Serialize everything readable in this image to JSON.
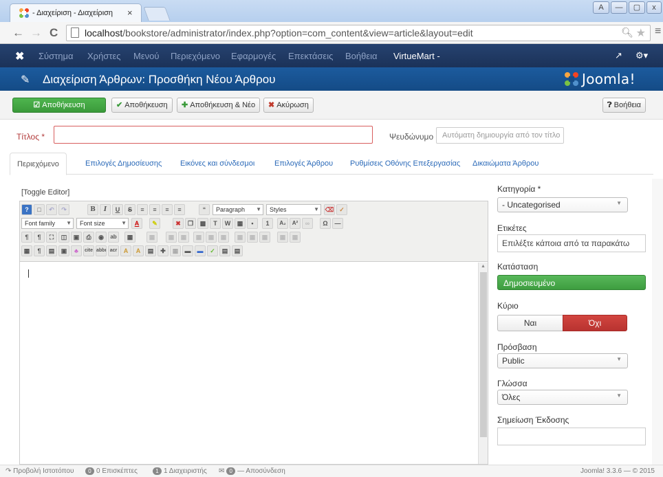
{
  "browser": {
    "tab_title": "- Διαχείριση - Διαχείριση",
    "tab_close": "×",
    "window_buttons": [
      "A",
      "—",
      "▢",
      "x"
    ],
    "url_host": "localhost",
    "url_path": "/bookstore/administrator/index.php?option=com_content&view=article&layout=edit",
    "back_icon": "←",
    "forward_icon": "→",
    "reload_icon": "C"
  },
  "admin_nav": {
    "items": [
      "Σύστημα",
      "Χρήστες",
      "Μενού",
      "Περιεχόμενο",
      "Εφαρμογές",
      "Επεκτάσεις",
      "Βοήθεια"
    ],
    "virtuemart": "VirtueMart -"
  },
  "header": {
    "title": "Διαχείριση Άρθρων: Προσθήκη Νέου Άρθρου",
    "logo_text": "Joomla!"
  },
  "toolbar": {
    "save": "Αποθήκευση",
    "save_close": "Αποθήκευση",
    "save_new": "Αποθήκευση & Νέο",
    "cancel": "Ακύρωση",
    "help": "Βοήθεια"
  },
  "form": {
    "title_label": "Τίτλος *",
    "title_value": "",
    "alias_label": "Ψευδώνυμο",
    "alias_placeholder": "Αυτόματη δημιουργία από τον τίτλο"
  },
  "tabs": [
    "Περιεχόμενο",
    "Επιλογές Δημοσίευσης",
    "Εικόνες και σύνδεσμοι",
    "Επιλογές Άρθρου",
    "Ρυθμίσεις Οθόνης Επεξεργασίας",
    "Δικαιώματα Άρθρου"
  ],
  "editor": {
    "toggle": "[Toggle Editor]",
    "paragraph": "Paragraph",
    "styles": "Styles",
    "font_family": "Font family",
    "font_size": "Font size"
  },
  "sidebar": {
    "category_label": "Κατηγορία *",
    "category_value": "- Uncategorised",
    "tags_label": "Ετικέτες",
    "tags_placeholder": "Επιλέξτε κάποια από τα παρακάτω",
    "status_label": "Κατάσταση",
    "status_value": "Δημοσιευμένο",
    "featured_label": "Κύριο",
    "featured_yes": "Ναι",
    "featured_no": "Όχι",
    "access_label": "Πρόσβαση",
    "access_value": "Public",
    "language_label": "Γλώσσα",
    "language_value": "Όλες",
    "version_note_label": "Σημείωση Έκδοσης",
    "version_note_value": ""
  },
  "footer": {
    "preview": "Προβολή Ιστοτόπου",
    "visitors_count": "0",
    "visitors": "0 Επισκέπτες",
    "admins_count": "1",
    "admins": "1 Διαχειριστής",
    "logout_count": "0",
    "logout": "— Αποσύνδεση",
    "version": "Joomla! 3.3.6 — © 2015"
  },
  "colors": {
    "nav_bg": "#1b3259",
    "header_bg": "#144b86",
    "save_green": "#3a9a3a",
    "status_green": "#3e9d40",
    "no_red": "#b83330",
    "link_blue": "#2a69b8"
  }
}
